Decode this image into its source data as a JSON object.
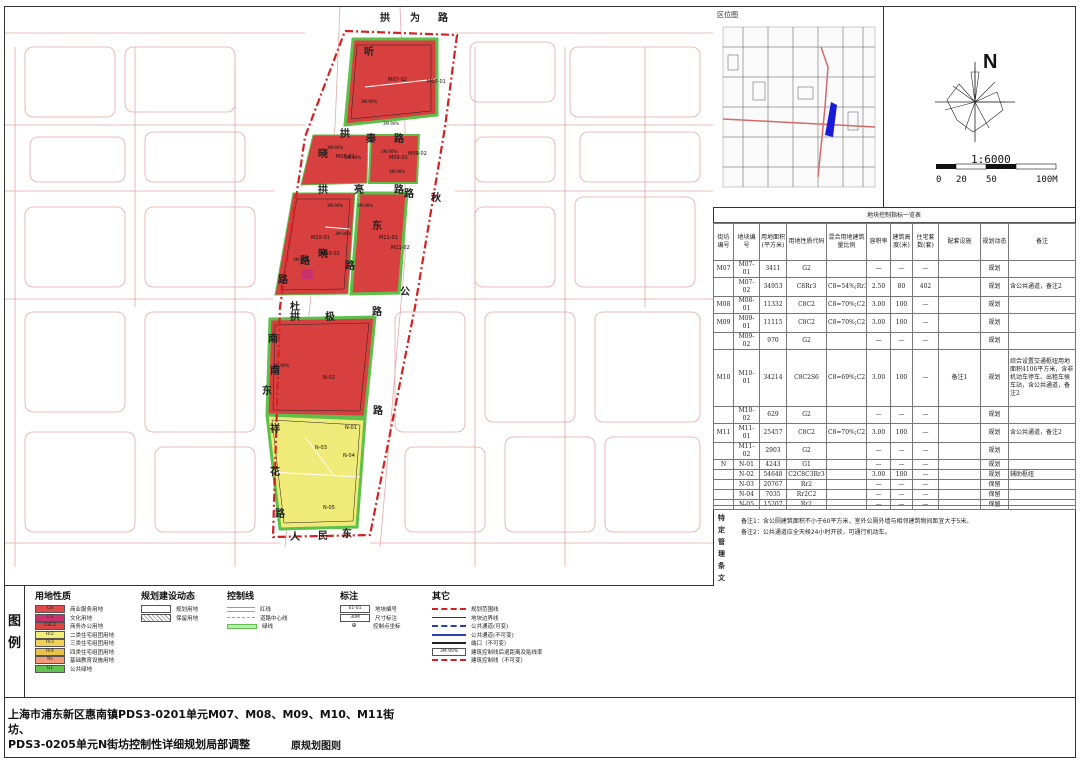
{
  "map": {
    "road_chars": [
      "拱",
      "为",
      "路",
      "听",
      "拱",
      "秦",
      "路",
      "晓",
      "拱",
      "亮",
      "路",
      "秋",
      "东",
      "拱",
      "极",
      "路",
      "公",
      "南",
      "东",
      "路",
      "祥",
      "花",
      "路",
      "人",
      "民",
      "东",
      "路",
      "路",
      "路",
      "南",
      "晓",
      "路",
      "杜"
    ],
    "parcels": [
      "M07-02",
      "M07-01",
      "M08-01",
      "M09-01",
      "M09-02",
      "M10-01",
      "M10-02",
      "M11-01",
      "M11-02",
      "N-02",
      "N-03",
      "N-04",
      "N-05",
      "N-01"
    ],
    "annotations": [
      "3M.90%",
      "3M.90%",
      "3M.90%",
      "3M.90%",
      "3M.90%",
      "3M.90%",
      "3M.90%",
      "3M.90%",
      "3M.90%",
      "3M.90%",
      "3M.90%"
    ]
  },
  "inset": {
    "title": "区位图"
  },
  "north": {
    "letter": "N",
    "scale": "1:6000",
    "ticks": [
      "0",
      "20",
      "50",
      "100M"
    ]
  },
  "table": {
    "title": "地块控制指标一览表",
    "headers": [
      "街坊编号",
      "地块编号",
      "用地面积(平方米)",
      "用地性质代码",
      "混合用地建筑量比例",
      "容积率",
      "建筑高度(米)",
      "住宅套数(套)",
      "配套设施",
      "规划动态",
      "备注"
    ],
    "rows": [
      [
        "M07",
        "M07-01",
        "3411",
        "G2",
        "",
        "—",
        "—",
        "—",
        "",
        "规划",
        ""
      ],
      [
        "",
        "M07-02",
        "34953",
        "C8Rr3",
        "C8=54%;Rr3=46%",
        "2.50",
        "80",
        "402",
        "",
        "规划",
        "含公共通道，备注2"
      ],
      [
        "M08",
        "M08-01",
        "11332",
        "C8C2",
        "C8=70%;C2=30%",
        "3.00",
        "100",
        "—",
        "",
        "规划",
        ""
      ],
      [
        "M09",
        "M09-01",
        "11115",
        "C8C2",
        "C8=70%;C2=30%",
        "3.00",
        "100",
        "—",
        "",
        "规划",
        ""
      ],
      [
        "",
        "M09-02",
        "970",
        "G2",
        "",
        "—",
        "—",
        "—",
        "",
        "规划",
        ""
      ],
      [
        "M10",
        "M10-01",
        "34214",
        "C8C2S6",
        "C8=69%;C2=40%;S6=1%",
        "3.00",
        "100",
        "—",
        "备注1",
        "规划",
        "综合设置交通枢纽用地面积4106平方米，含非机动车停车、出租车候车站，含公共通道，备注2"
      ],
      [
        "",
        "M10-02",
        "629",
        "G2",
        "",
        "—",
        "—",
        "—",
        "",
        "规划",
        ""
      ],
      [
        "M11",
        "M11-01",
        "25457",
        "C8C2",
        "C8=70%;C2=30%",
        "3.00",
        "100",
        "—",
        "",
        "规划",
        "含公共通道，备注2"
      ],
      [
        "",
        "M11-02",
        "2903",
        "G2",
        "",
        "—",
        "—",
        "—",
        "",
        "规划",
        ""
      ],
      [
        "N",
        "N-01",
        "4243",
        "G1",
        "",
        "—",
        "—",
        "—",
        "",
        "规划",
        ""
      ],
      [
        "",
        "N-02",
        "54648",
        "C2C8C3Rr3",
        "",
        "3.00",
        "100",
        "—",
        "",
        "规划",
        "辅助枢纽"
      ],
      [
        "",
        "N-03",
        "20767",
        "Rr2",
        "",
        "—",
        "—",
        "—",
        "",
        "保留",
        ""
      ],
      [
        "",
        "N-04",
        "7035",
        "Rr2C2",
        "",
        "—",
        "—",
        "—",
        "",
        "保留",
        ""
      ],
      [
        "",
        "N-05",
        "15207",
        "Rr2",
        "",
        "—",
        "—",
        "—",
        "",
        "保留",
        ""
      ]
    ]
  },
  "special": {
    "label": "特定管理条文",
    "notes": [
      "备注1：含公厕建筑面积不小于60平方米，室外公厕外墙与相邻建筑物间距宜大于5米。",
      "备注2：公共通道应全天候24小时开放，可通行机动车。"
    ]
  },
  "legend": {
    "side": [
      "图",
      "例"
    ],
    "land_use": {
      "title": "用地性质",
      "items": [
        {
          "code": "C8",
          "label": "商业服务用地",
          "color": "#e04a4a"
        },
        {
          "code": "C3",
          "label": "文化用地",
          "color": "#c8326e"
        },
        {
          "code": "C8C2",
          "label": "商务办公用地",
          "color": "#d94444"
        },
        {
          "code": "Rr2",
          "label": "二类住宅组团用地",
          "color": "#f2ec7a"
        },
        {
          "code": "Rr3",
          "label": "三类住宅组团用地",
          "color": "#f0d25a"
        },
        {
          "code": "Rr4",
          "label": "四类住宅组团用地",
          "color": "#e8c24a"
        },
        {
          "code": "Rs",
          "label": "基础教育设施用地",
          "color": "#f29a7a"
        },
        {
          "code": "G1",
          "label": "公共绿地",
          "color": "#62c24e"
        }
      ]
    },
    "dynamic": {
      "title": "规划建设动态",
      "items": [
        {
          "label": "规划用地"
        },
        {
          "label": "保留用地"
        }
      ]
    },
    "control": {
      "title": "控制线",
      "items": [
        {
          "label": "红线"
        },
        {
          "label": "道路中心线"
        },
        {
          "label": "绿线"
        }
      ]
    },
    "marks": {
      "title": "标注",
      "items": [
        {
          "sample": "01-01",
          "label": "地块编号"
        },
        {
          "sample": "30M",
          "label": "尺寸标注"
        },
        {
          "sample": "",
          "label": "控制点坐标"
        }
      ]
    },
    "other": {
      "title": "其它",
      "items": [
        {
          "label": "规划范围线"
        },
        {
          "label": "地块边界线"
        },
        {
          "label": "公共通道(可变)"
        },
        {
          "label": "公共通道(不可变)"
        },
        {
          "label": "端口（不可变）"
        },
        {
          "sample": "3M.90%",
          "label": "建筑控制线后退距离及贴线率"
        },
        {
          "label": "建筑控制线（不可变）"
        }
      ]
    }
  },
  "title_block": {
    "line1": "上海市浦东新区惠南镇PDS3-0201单元M07、M08、M09、M10、M11街坊、",
    "line2": "PDS3-0205单元N街坊控制性详细规划局部调整",
    "subtitle": "原规划图则"
  },
  "colors": {
    "commercial": "#d84040",
    "residential": "#f0ea78",
    "green": "#5cc04a",
    "boundary": "#d42020",
    "road": "#e8a0a0"
  }
}
